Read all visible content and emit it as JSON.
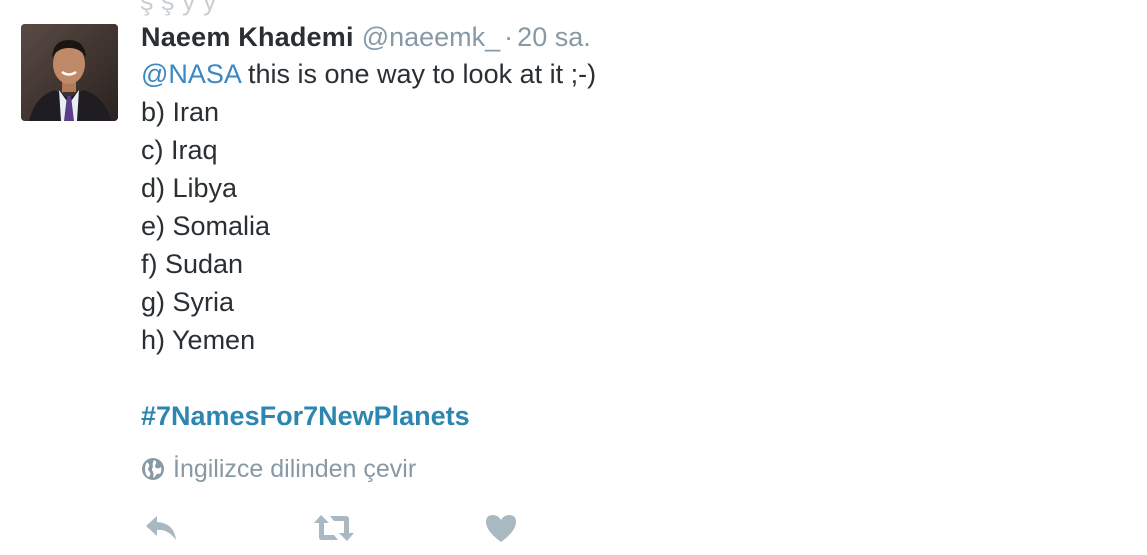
{
  "cutoff_text": "ş ş y y",
  "tweet": {
    "fullname": "Naeem Khademi",
    "handle": "@naeemk_",
    "dot": "·",
    "time": "20 sa.",
    "mention": "@NASA",
    "first_line_rest": " this is one way to look at it ;-)",
    "lines": [
      "b) Iran",
      "c) Iraq",
      "d) Libya",
      "e) Somalia",
      "f) Sudan",
      "g) Syria",
      "h) Yemen"
    ],
    "hashtag": "#7NamesFor7NewPlanets",
    "translate_label": "İngilizce dilinden çevir"
  },
  "actions": {
    "reply_icon": "reply-icon",
    "retweet_icon": "retweet-icon",
    "like_icon": "heart-icon",
    "icon_color": "#aab8c2"
  },
  "colors": {
    "text": "#292f33",
    "muted": "#8899a6",
    "link": "#2d86b0"
  }
}
